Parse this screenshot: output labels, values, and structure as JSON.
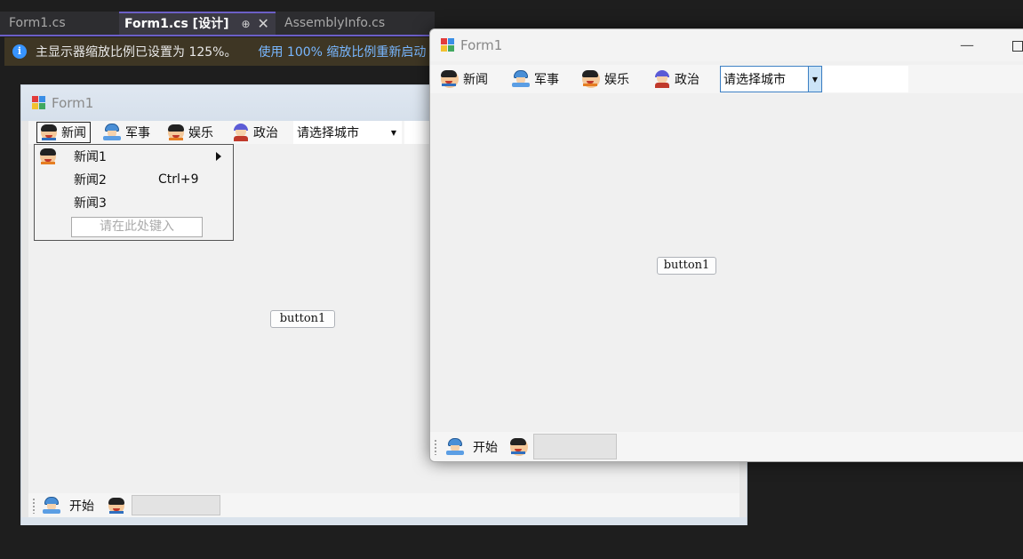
{
  "ide": {
    "tabs": [
      {
        "label": "Form1.cs"
      },
      {
        "label": "Form1.cs [设计]",
        "pin": "⊕",
        "close": "✕"
      },
      {
        "label": "AssemblyInfo.cs"
      }
    ],
    "infobar": {
      "message": "主显示器缩放比例已设置为 125%。",
      "action_link": "使用 100% 缩放比例重新启动"
    }
  },
  "designer": {
    "title": "Form1",
    "menu": [
      "新闻",
      "军事",
      "娱乐",
      "政治"
    ],
    "combo_text": "请选择城市",
    "dropdown": {
      "items": [
        {
          "label": "新闻1",
          "has_submenu": true
        },
        {
          "label": "新闻2",
          "shortcut": "Ctrl+9"
        },
        {
          "label": "新闻3"
        }
      ],
      "placeholder": "请在此处键入"
    },
    "button": "button1",
    "status": {
      "label": "开始"
    }
  },
  "runtime": {
    "title": "Form1",
    "menu": [
      "新闻",
      "军事",
      "娱乐",
      "政治"
    ],
    "combo_text": "请选择城市",
    "button": "button1",
    "status": {
      "label": "开始"
    }
  },
  "colors": {
    "tab_accent": "#6c5fc7",
    "info_link": "#78b7ff",
    "info_bar": "#3e3624",
    "ide_background": "#1e1e1e"
  }
}
